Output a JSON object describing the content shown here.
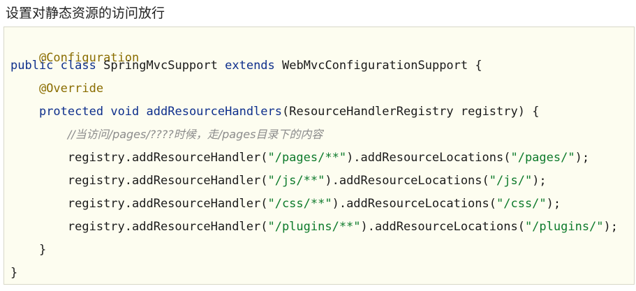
{
  "heading": "设置对静态资源的访问放行",
  "code": {
    "line1_annotation": "@Configuration",
    "line2_public": "public",
    "line2_class": "class",
    "line2_name": "SpringMvcSupport",
    "line2_extends": "extends",
    "line2_parent": "WebMvcConfigurationSupport {",
    "line3_annotation": "@Override",
    "line4_protected": "protected",
    "line4_void": "void",
    "line4_method": "addResourceHandlers",
    "line4_params": "(ResourceHandlerRegistry registry) {",
    "line5_comment": "//当访问/pages/????时候，走/pages目录下的内容",
    "call_handler": "registry.addResourceHandler(",
    "call_locations": ").addResourceLocations(",
    "call_end": ");",
    "mappings": [
      {
        "pattern": "\"/pages/**\"",
        "location": "\"/pages/\""
      },
      {
        "pattern": "\"/js/**\"",
        "location": "\"/js/\""
      },
      {
        "pattern": "\"/css/**\"",
        "location": "\"/css/\""
      },
      {
        "pattern": "\"/plugins/**\"",
        "location": "\"/plugins/\""
      }
    ],
    "method_close": "}",
    "class_close": "}"
  }
}
